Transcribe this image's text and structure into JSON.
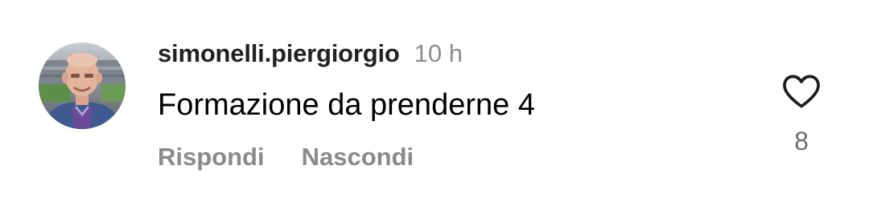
{
  "comment": {
    "username": "simonelli.piergiorgio",
    "timestamp": "10 h",
    "text": "Formazione da prenderne 4",
    "actions": {
      "reply_label": "Rispondi",
      "hide_label": "Nascondi"
    },
    "like": {
      "icon": "heart-outline-icon",
      "count": "8"
    },
    "avatar": {
      "description_icon": "user-avatar-photo"
    }
  },
  "colors": {
    "username": "#222222",
    "secondary_text": "#8e8e8e",
    "action_text": "#8a8a8a",
    "heart_stroke": "#1c1c1c",
    "background": "#ffffff"
  }
}
